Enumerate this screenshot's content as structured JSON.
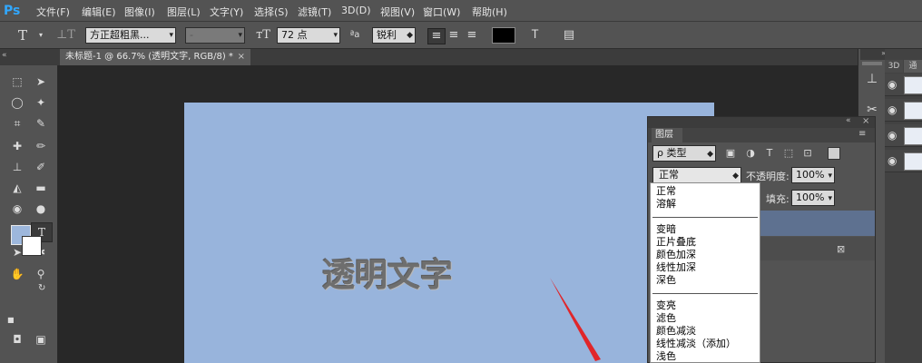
{
  "app": {
    "logo": "Ps"
  },
  "menu": [
    "文件(F)",
    "编辑(E)",
    "图像(I)",
    "图层(L)",
    "文字(Y)",
    "选择(S)",
    "滤镜(T)",
    "3D(D)",
    "视图(V)",
    "窗口(W)",
    "帮助(H)"
  ],
  "options": {
    "font_family": "方正超粗黑...",
    "font_style": "-",
    "font_size": "72 点",
    "aa_label": "ªa",
    "aa_mode": "锐利",
    "text_color": "#000000"
  },
  "document": {
    "tab_title": "未标题-1 @ 66.7% (透明文字, RGB/8) *",
    "canvas_text": "透明文字",
    "canvas_color": "#98b4dc"
  },
  "swatches": {
    "foreground": "#9db7dc",
    "background": "#ffffff"
  },
  "layers_panel": {
    "tab_label": "图层",
    "filter_label": "ρ 类型",
    "blend_mode": "正常",
    "opacity_label": "不透明度:",
    "opacity_value": "100%",
    "fill_label": "填充:",
    "fill_value": "100%"
  },
  "blend_modes": {
    "group1": [
      "正常",
      "溶解"
    ],
    "group2": [
      "变暗",
      "正片叠底",
      "颜色加深",
      "线性加深",
      "深色"
    ],
    "group3": [
      "变亮",
      "滤色",
      "颜色减淡",
      "线性减淡（添加）",
      "浅色"
    ]
  },
  "right_strip": {
    "tab_3d": "3D",
    "tab_other": "通"
  },
  "colors": {
    "accent_arrow": "#e0262a",
    "selected_layer": "#5e7190"
  }
}
